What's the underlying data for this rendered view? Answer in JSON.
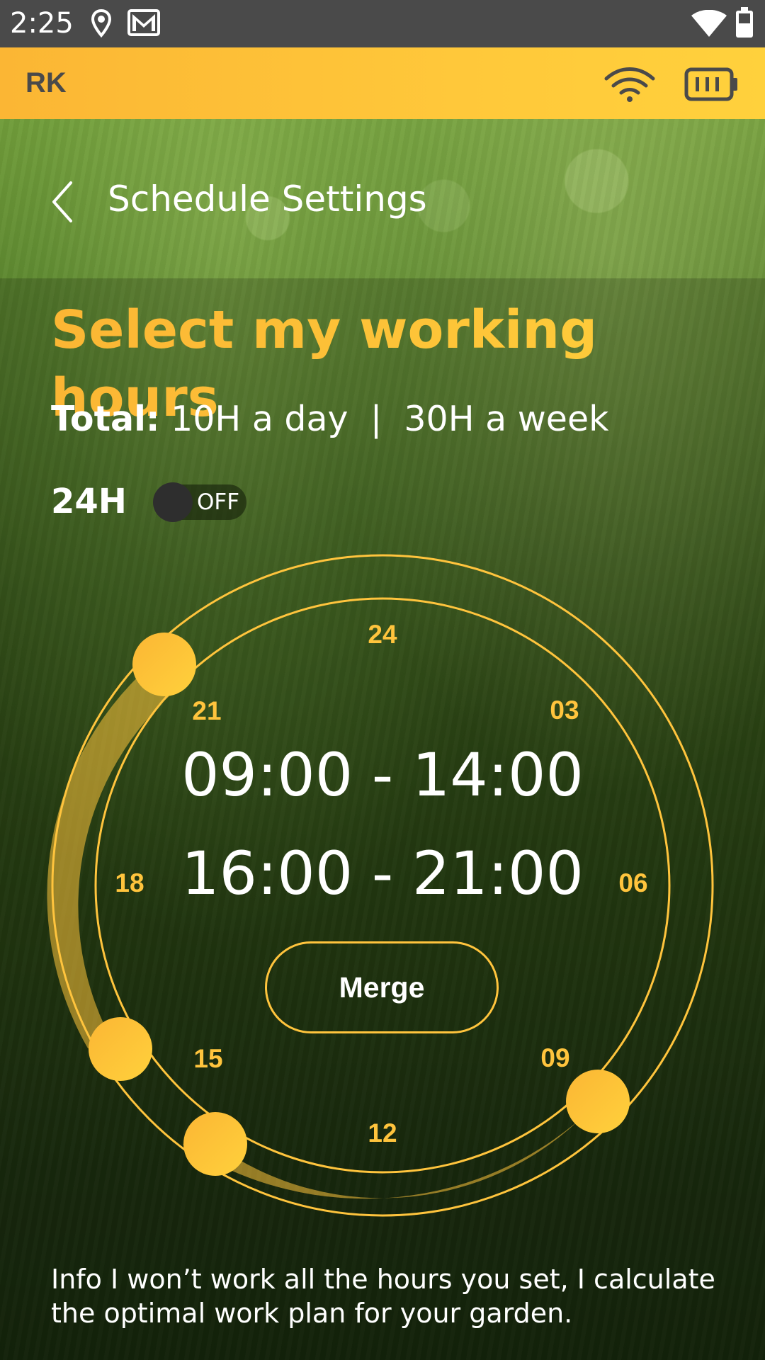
{
  "status_bar": {
    "time": "2:25",
    "icons": [
      "location-icon",
      "gmail-icon",
      "wifi-signal-icon",
      "battery-icon"
    ]
  },
  "app_bar": {
    "logo": "RK",
    "icons": [
      "wifi-icon",
      "battery-icon"
    ],
    "colors": {
      "gradient_start": "#fbb634",
      "gradient_end": "#ffd13c"
    }
  },
  "header": {
    "title": "Schedule Settings",
    "back_icon": "chevron-left-icon"
  },
  "heading": "Select my working hours",
  "totals": {
    "label": "Total:",
    "value": " 10H a day  |  30H a week"
  },
  "toggle": {
    "label": "24H",
    "state": "OFF",
    "on": false
  },
  "dial": {
    "hour_labels": [
      "24",
      "03",
      "06",
      "09",
      "12",
      "15",
      "18",
      "21"
    ],
    "ranges": [
      "09:00 - 14:00",
      "16:00 - 21:00"
    ],
    "accent_color": "#ffc43d"
  },
  "merge_button": "Merge",
  "info_text": "Info I won’t work all the hours you set, I calculate the optimal work plan for your garden."
}
